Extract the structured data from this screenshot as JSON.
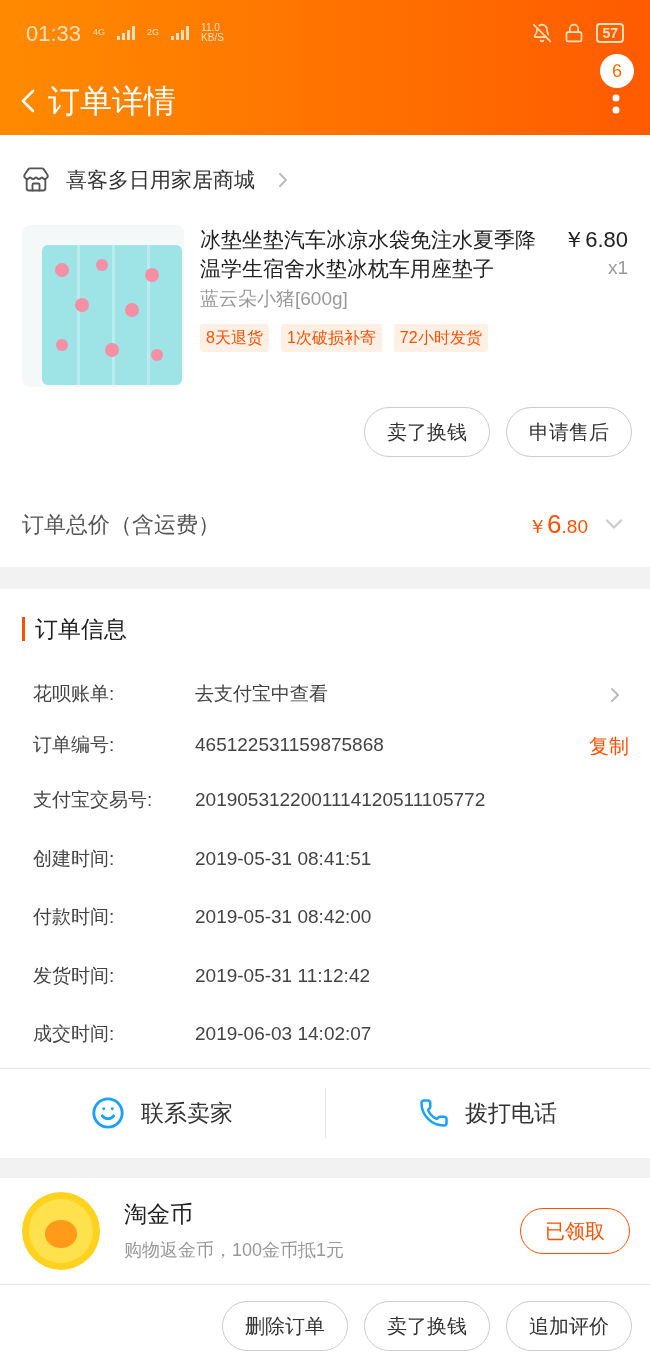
{
  "status_bar": {
    "time": "01:33",
    "net1": "4G",
    "net2": "2G",
    "speed": "11.0",
    "speed_unit": "KB/S",
    "battery": "57"
  },
  "header": {
    "title": "订单详情",
    "badge": "6"
  },
  "shop": {
    "name": "喜客多日用家居商城"
  },
  "product": {
    "title": "冰垫坐垫汽车冰凉水袋免注水夏季降温学生宿舍水垫冰枕车用座垫子",
    "price": "￥6.80",
    "qty": "x1",
    "sku": "蓝云朵小猪[600g]",
    "tags": [
      "8天退货",
      "1次破损补寄",
      "72小时发货"
    ],
    "buttons": [
      "卖了换钱",
      "申请售后"
    ]
  },
  "total": {
    "label": "订单总价（含运费）",
    "currency": "￥",
    "int": "6",
    "dec": ".80"
  },
  "order_info": {
    "title": "订单信息",
    "rows": [
      {
        "label": "花呗账单:",
        "value": "去支付宝中查看",
        "kind": "link"
      },
      {
        "label": "订单编号:",
        "value": "465122531159875868",
        "kind": "copy",
        "action": "复制"
      },
      {
        "label": "支付宝交易号:",
        "value": "2019053122001114120511105772",
        "kind": "plain"
      },
      {
        "label": "创建时间:",
        "value": "2019-05-31 08:41:51",
        "kind": "plain"
      },
      {
        "label": "付款时间:",
        "value": "2019-05-31 08:42:00",
        "kind": "plain"
      },
      {
        "label": "发货时间:",
        "value": "2019-05-31 11:12:42",
        "kind": "plain"
      },
      {
        "label": "成交时间:",
        "value": "2019-06-03 14:02:07",
        "kind": "plain"
      }
    ]
  },
  "contact": {
    "chat": "联系卖家",
    "call": "拨打电话"
  },
  "coin": {
    "title": "淘金币",
    "subtitle": "购物返金币，100金币抵1元",
    "button": "已领取"
  },
  "bottom_buttons": [
    "删除订单",
    "卖了换钱",
    "追加评价"
  ]
}
